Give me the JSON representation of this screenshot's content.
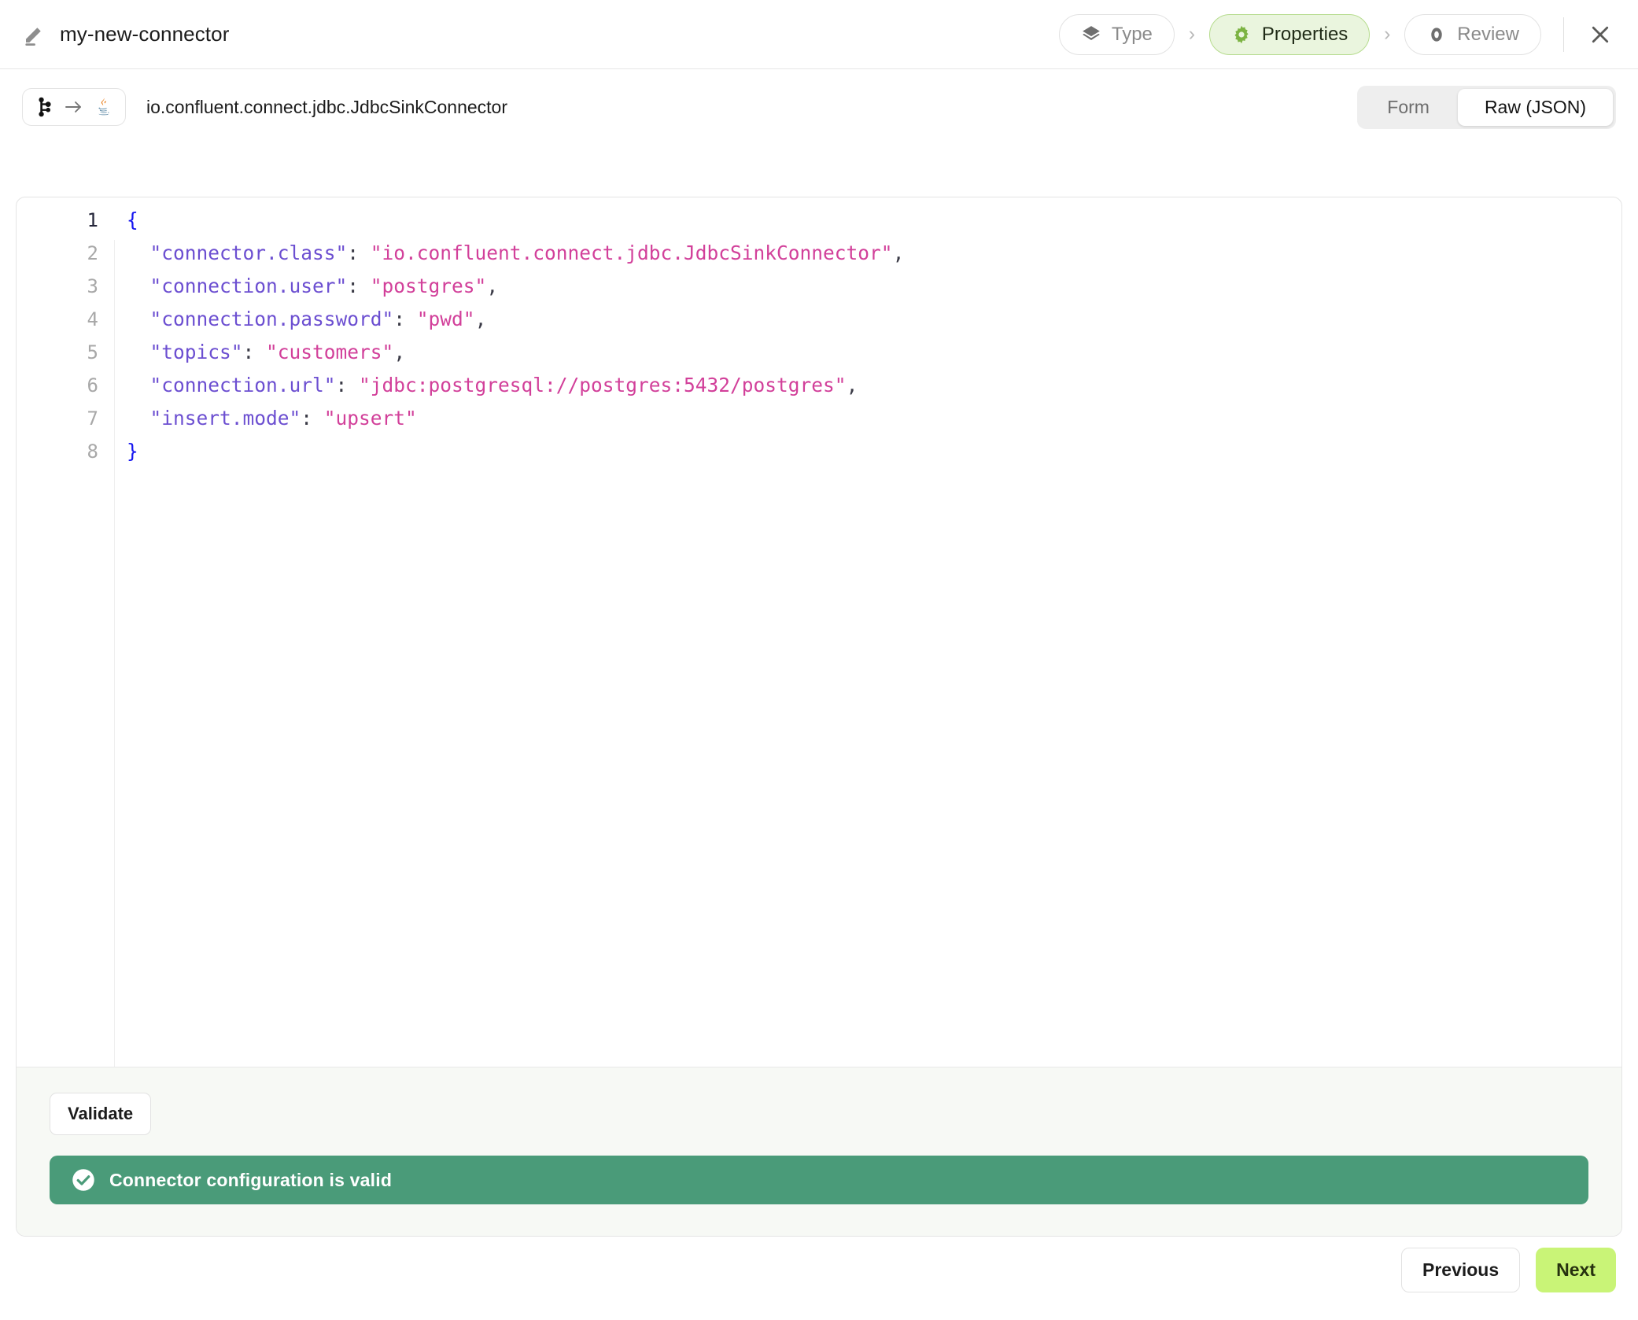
{
  "header": {
    "edit_icon": "pencil-icon",
    "title": "my-new-connector",
    "close_icon": "close-icon",
    "steps": [
      {
        "label": "Type",
        "icon": "layers-icon",
        "active": false
      },
      {
        "label": "Properties",
        "icon": "gear-icon",
        "active": true
      },
      {
        "label": "Review",
        "icon": "eye-icon",
        "active": false
      }
    ],
    "separator": "›"
  },
  "subbar": {
    "source_icon": "kafka-icon",
    "flow_icon": "arrow-right-icon",
    "target_icon": "java-icon",
    "connector_class": "io.confluent.connect.jdbc.JdbcSinkConnector",
    "view_toggle": {
      "options": [
        "Form",
        "Raw (JSON)"
      ],
      "selected": "Raw (JSON)"
    }
  },
  "editor": {
    "language": "json",
    "active_line": 1,
    "lines": [
      {
        "n": "1",
        "segments": [
          {
            "t": "{",
            "c": "brace"
          }
        ]
      },
      {
        "n": "2",
        "segments": [
          {
            "t": "  ",
            "c": "punc"
          },
          {
            "t": "\"connector.class\"",
            "c": "key"
          },
          {
            "t": ": ",
            "c": "punc"
          },
          {
            "t": "\"io.confluent.connect.jdbc.JdbcSinkConnector\"",
            "c": "str"
          },
          {
            "t": ",",
            "c": "punc"
          }
        ]
      },
      {
        "n": "3",
        "segments": [
          {
            "t": "  ",
            "c": "punc"
          },
          {
            "t": "\"connection.user\"",
            "c": "key"
          },
          {
            "t": ": ",
            "c": "punc"
          },
          {
            "t": "\"postgres\"",
            "c": "str"
          },
          {
            "t": ",",
            "c": "punc"
          }
        ]
      },
      {
        "n": "4",
        "segments": [
          {
            "t": "  ",
            "c": "punc"
          },
          {
            "t": "\"connection.password\"",
            "c": "key"
          },
          {
            "t": ": ",
            "c": "punc"
          },
          {
            "t": "\"pwd\"",
            "c": "str"
          },
          {
            "t": ",",
            "c": "punc"
          }
        ]
      },
      {
        "n": "5",
        "segments": [
          {
            "t": "  ",
            "c": "punc"
          },
          {
            "t": "\"topics\"",
            "c": "key"
          },
          {
            "t": ": ",
            "c": "punc"
          },
          {
            "t": "\"customers\"",
            "c": "str"
          },
          {
            "t": ",",
            "c": "punc"
          }
        ]
      },
      {
        "n": "6",
        "segments": [
          {
            "t": "  ",
            "c": "punc"
          },
          {
            "t": "\"connection.url\"",
            "c": "key"
          },
          {
            "t": ": ",
            "c": "punc"
          },
          {
            "t": "\"jdbc:postgresql://postgres:5432/postgres\"",
            "c": "str"
          },
          {
            "t": ",",
            "c": "punc"
          }
        ]
      },
      {
        "n": "7",
        "segments": [
          {
            "t": "  ",
            "c": "punc"
          },
          {
            "t": "\"insert.mode\"",
            "c": "key"
          },
          {
            "t": ": ",
            "c": "punc"
          },
          {
            "t": "\"upsert\"",
            "c": "str"
          }
        ]
      },
      {
        "n": "8",
        "segments": [
          {
            "t": "}",
            "c": "brace"
          }
        ]
      }
    ]
  },
  "validation": {
    "validate_label": "Validate",
    "status_icon": "check-circle-icon",
    "status_message": "Connector configuration is valid",
    "status_color": "#4a9b79"
  },
  "footer_nav": {
    "previous_label": "Previous",
    "next_label": "Next",
    "next_color": "#c9f477"
  }
}
